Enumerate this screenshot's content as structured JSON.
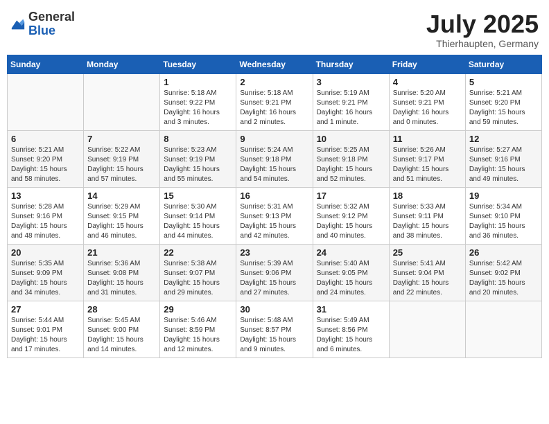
{
  "header": {
    "logo_general": "General",
    "logo_blue": "Blue",
    "month_year": "July 2025",
    "location": "Thierhaupten, Germany"
  },
  "weekdays": [
    "Sunday",
    "Monday",
    "Tuesday",
    "Wednesday",
    "Thursday",
    "Friday",
    "Saturday"
  ],
  "weeks": [
    [
      {
        "day": "",
        "info": ""
      },
      {
        "day": "",
        "info": ""
      },
      {
        "day": "1",
        "info": "Sunrise: 5:18 AM\nSunset: 9:22 PM\nDaylight: 16 hours and 3 minutes."
      },
      {
        "day": "2",
        "info": "Sunrise: 5:18 AM\nSunset: 9:21 PM\nDaylight: 16 hours and 2 minutes."
      },
      {
        "day": "3",
        "info": "Sunrise: 5:19 AM\nSunset: 9:21 PM\nDaylight: 16 hours and 1 minute."
      },
      {
        "day": "4",
        "info": "Sunrise: 5:20 AM\nSunset: 9:21 PM\nDaylight: 16 hours and 0 minutes."
      },
      {
        "day": "5",
        "info": "Sunrise: 5:21 AM\nSunset: 9:20 PM\nDaylight: 15 hours and 59 minutes."
      }
    ],
    [
      {
        "day": "6",
        "info": "Sunrise: 5:21 AM\nSunset: 9:20 PM\nDaylight: 15 hours and 58 minutes."
      },
      {
        "day": "7",
        "info": "Sunrise: 5:22 AM\nSunset: 9:19 PM\nDaylight: 15 hours and 57 minutes."
      },
      {
        "day": "8",
        "info": "Sunrise: 5:23 AM\nSunset: 9:19 PM\nDaylight: 15 hours and 55 minutes."
      },
      {
        "day": "9",
        "info": "Sunrise: 5:24 AM\nSunset: 9:18 PM\nDaylight: 15 hours and 54 minutes."
      },
      {
        "day": "10",
        "info": "Sunrise: 5:25 AM\nSunset: 9:18 PM\nDaylight: 15 hours and 52 minutes."
      },
      {
        "day": "11",
        "info": "Sunrise: 5:26 AM\nSunset: 9:17 PM\nDaylight: 15 hours and 51 minutes."
      },
      {
        "day": "12",
        "info": "Sunrise: 5:27 AM\nSunset: 9:16 PM\nDaylight: 15 hours and 49 minutes."
      }
    ],
    [
      {
        "day": "13",
        "info": "Sunrise: 5:28 AM\nSunset: 9:16 PM\nDaylight: 15 hours and 48 minutes."
      },
      {
        "day": "14",
        "info": "Sunrise: 5:29 AM\nSunset: 9:15 PM\nDaylight: 15 hours and 46 minutes."
      },
      {
        "day": "15",
        "info": "Sunrise: 5:30 AM\nSunset: 9:14 PM\nDaylight: 15 hours and 44 minutes."
      },
      {
        "day": "16",
        "info": "Sunrise: 5:31 AM\nSunset: 9:13 PM\nDaylight: 15 hours and 42 minutes."
      },
      {
        "day": "17",
        "info": "Sunrise: 5:32 AM\nSunset: 9:12 PM\nDaylight: 15 hours and 40 minutes."
      },
      {
        "day": "18",
        "info": "Sunrise: 5:33 AM\nSunset: 9:11 PM\nDaylight: 15 hours and 38 minutes."
      },
      {
        "day": "19",
        "info": "Sunrise: 5:34 AM\nSunset: 9:10 PM\nDaylight: 15 hours and 36 minutes."
      }
    ],
    [
      {
        "day": "20",
        "info": "Sunrise: 5:35 AM\nSunset: 9:09 PM\nDaylight: 15 hours and 34 minutes."
      },
      {
        "day": "21",
        "info": "Sunrise: 5:36 AM\nSunset: 9:08 PM\nDaylight: 15 hours and 31 minutes."
      },
      {
        "day": "22",
        "info": "Sunrise: 5:38 AM\nSunset: 9:07 PM\nDaylight: 15 hours and 29 minutes."
      },
      {
        "day": "23",
        "info": "Sunrise: 5:39 AM\nSunset: 9:06 PM\nDaylight: 15 hours and 27 minutes."
      },
      {
        "day": "24",
        "info": "Sunrise: 5:40 AM\nSunset: 9:05 PM\nDaylight: 15 hours and 24 minutes."
      },
      {
        "day": "25",
        "info": "Sunrise: 5:41 AM\nSunset: 9:04 PM\nDaylight: 15 hours and 22 minutes."
      },
      {
        "day": "26",
        "info": "Sunrise: 5:42 AM\nSunset: 9:02 PM\nDaylight: 15 hours and 20 minutes."
      }
    ],
    [
      {
        "day": "27",
        "info": "Sunrise: 5:44 AM\nSunset: 9:01 PM\nDaylight: 15 hours and 17 minutes."
      },
      {
        "day": "28",
        "info": "Sunrise: 5:45 AM\nSunset: 9:00 PM\nDaylight: 15 hours and 14 minutes."
      },
      {
        "day": "29",
        "info": "Sunrise: 5:46 AM\nSunset: 8:59 PM\nDaylight: 15 hours and 12 minutes."
      },
      {
        "day": "30",
        "info": "Sunrise: 5:48 AM\nSunset: 8:57 PM\nDaylight: 15 hours and 9 minutes."
      },
      {
        "day": "31",
        "info": "Sunrise: 5:49 AM\nSunset: 8:56 PM\nDaylight: 15 hours and 6 minutes."
      },
      {
        "day": "",
        "info": ""
      },
      {
        "day": "",
        "info": ""
      }
    ]
  ]
}
